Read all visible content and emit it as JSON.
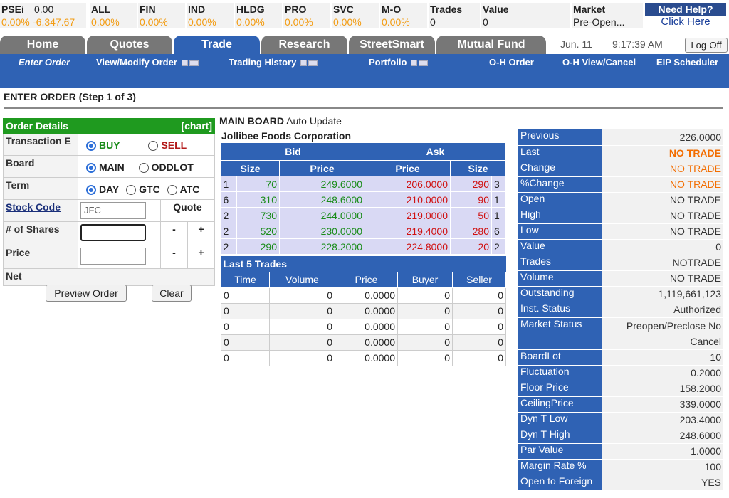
{
  "ticker": [
    {
      "name": "PSEi",
      "v1": "0.00",
      "v2": "0.00%",
      "v3": "-6,347.67"
    },
    {
      "name": "ALL",
      "v2": "0.00%"
    },
    {
      "name": "FIN",
      "v2": "0.00%"
    },
    {
      "name": "IND",
      "v2": "0.00%"
    },
    {
      "name": "HLDG",
      "v2": "0.00%"
    },
    {
      "name": "PRO",
      "v2": "0.00%"
    },
    {
      "name": "SVC",
      "v2": "0.00%"
    },
    {
      "name": "M-O",
      "v2": "0.00%"
    },
    {
      "name": "Trades",
      "v2": "0"
    },
    {
      "name": "Value",
      "v2": "0"
    },
    {
      "name": "Market",
      "v2": "Pre-Open..."
    }
  ],
  "help": {
    "title": "Need Help?",
    "link": "Click Here"
  },
  "tabs": [
    "Home",
    "Quotes",
    "Trade",
    "Research",
    "StreetSmart",
    "Mutual Fund"
  ],
  "date": "Jun. 11",
  "time": "9:17:39 AM",
  "logoff": "Log-Off",
  "subnav": [
    "Enter Order",
    "View/Modify Order",
    "Trading History",
    "Portfolio",
    "O-H Order",
    "O-H View/Cancel",
    "EIP Scheduler"
  ],
  "step_title": "ENTER ORDER (Step 1 of 3)",
  "order": {
    "header": "Order Details",
    "chart": "[chart]",
    "tx_label": "Transaction E",
    "buy": "BUY",
    "sell": "SELL",
    "board_label": "Board",
    "main": "MAIN",
    "oddlot": "ODDLOT",
    "term_label": "Term",
    "day": "DAY",
    "gtc": "GTC",
    "atc": "ATC",
    "stock_label": "Stock Code",
    "stock_value": "JFC",
    "quote": "Quote",
    "shares_label": "# of Shares",
    "price_label": "Price",
    "net_label": "Net",
    "minus": "-",
    "plus": "+",
    "preview": "Preview Order",
    "clear": "Clear"
  },
  "board": {
    "title": "MAIN BOARD",
    "auto": "Auto Update",
    "company": "Jollibee Foods Corporation",
    "bid": "Bid",
    "ask": "Ask",
    "size": "Size",
    "price": "Price",
    "rows": [
      {
        "bc": "1",
        "bs": "70",
        "bp": "249.6000",
        "ap": "206.0000",
        "as": "290",
        "ac": "3"
      },
      {
        "bc": "6",
        "bs": "310",
        "bp": "248.6000",
        "ap": "210.0000",
        "as": "90",
        "ac": "1"
      },
      {
        "bc": "2",
        "bs": "730",
        "bp": "244.0000",
        "ap": "219.0000",
        "as": "50",
        "ac": "1"
      },
      {
        "bc": "2",
        "bs": "520",
        "bp": "230.0000",
        "ap": "219.4000",
        "as": "280",
        "ac": "6"
      },
      {
        "bc": "2",
        "bs": "290",
        "bp": "228.2000",
        "ap": "224.8000",
        "as": "20",
        "ac": "2"
      }
    ]
  },
  "last5": {
    "title": "Last 5 Trades",
    "cols": [
      "Time",
      "Volume",
      "Price",
      "Buyer",
      "Seller"
    ],
    "rows": [
      [
        "0",
        "0",
        "0.0000",
        "0",
        "0"
      ],
      [
        "0",
        "0",
        "0.0000",
        "0",
        "0"
      ],
      [
        "0",
        "0",
        "0.0000",
        "0",
        "0"
      ],
      [
        "0",
        "0",
        "0.0000",
        "0",
        "0"
      ],
      [
        "0",
        "0",
        "0.0000",
        "0",
        "0"
      ]
    ]
  },
  "stats": [
    {
      "k": "Previous",
      "v": "226.0000"
    },
    {
      "k": "Last",
      "v": "NO TRADE"
    },
    {
      "k": "Change",
      "v": "NO TRADE"
    },
    {
      "k": "%Change",
      "v": "NO TRADE"
    },
    {
      "k": "Open",
      "v": "NO TRADE"
    },
    {
      "k": "High",
      "v": "NO TRADE"
    },
    {
      "k": "Low",
      "v": "NO TRADE"
    },
    {
      "k": "Value",
      "v": "0"
    },
    {
      "k": "Trades",
      "v": "NOTRADE"
    },
    {
      "k": "Volume",
      "v": "NO TRADE"
    },
    {
      "k": "Outstanding",
      "v": "1,119,661,123"
    },
    {
      "k": "Inst. Status",
      "v": "Authorized"
    },
    {
      "k": "Market Status",
      "v": "Preopen/Preclose No Cancel"
    },
    {
      "k": "BoardLot",
      "v": "10"
    },
    {
      "k": "Fluctuation",
      "v": "0.2000"
    },
    {
      "k": "Floor Price",
      "v": "158.2000"
    },
    {
      "k": "CeilingPrice",
      "v": "339.0000"
    },
    {
      "k": "Dyn T Low",
      "v": "203.4000"
    },
    {
      "k": "Dyn T High",
      "v": "248.6000"
    },
    {
      "k": "Par Value",
      "v": "1.0000"
    },
    {
      "k": "Margin Rate %",
      "v": "100"
    },
    {
      "k": "Open to Foreign",
      "v": "YES"
    }
  ]
}
